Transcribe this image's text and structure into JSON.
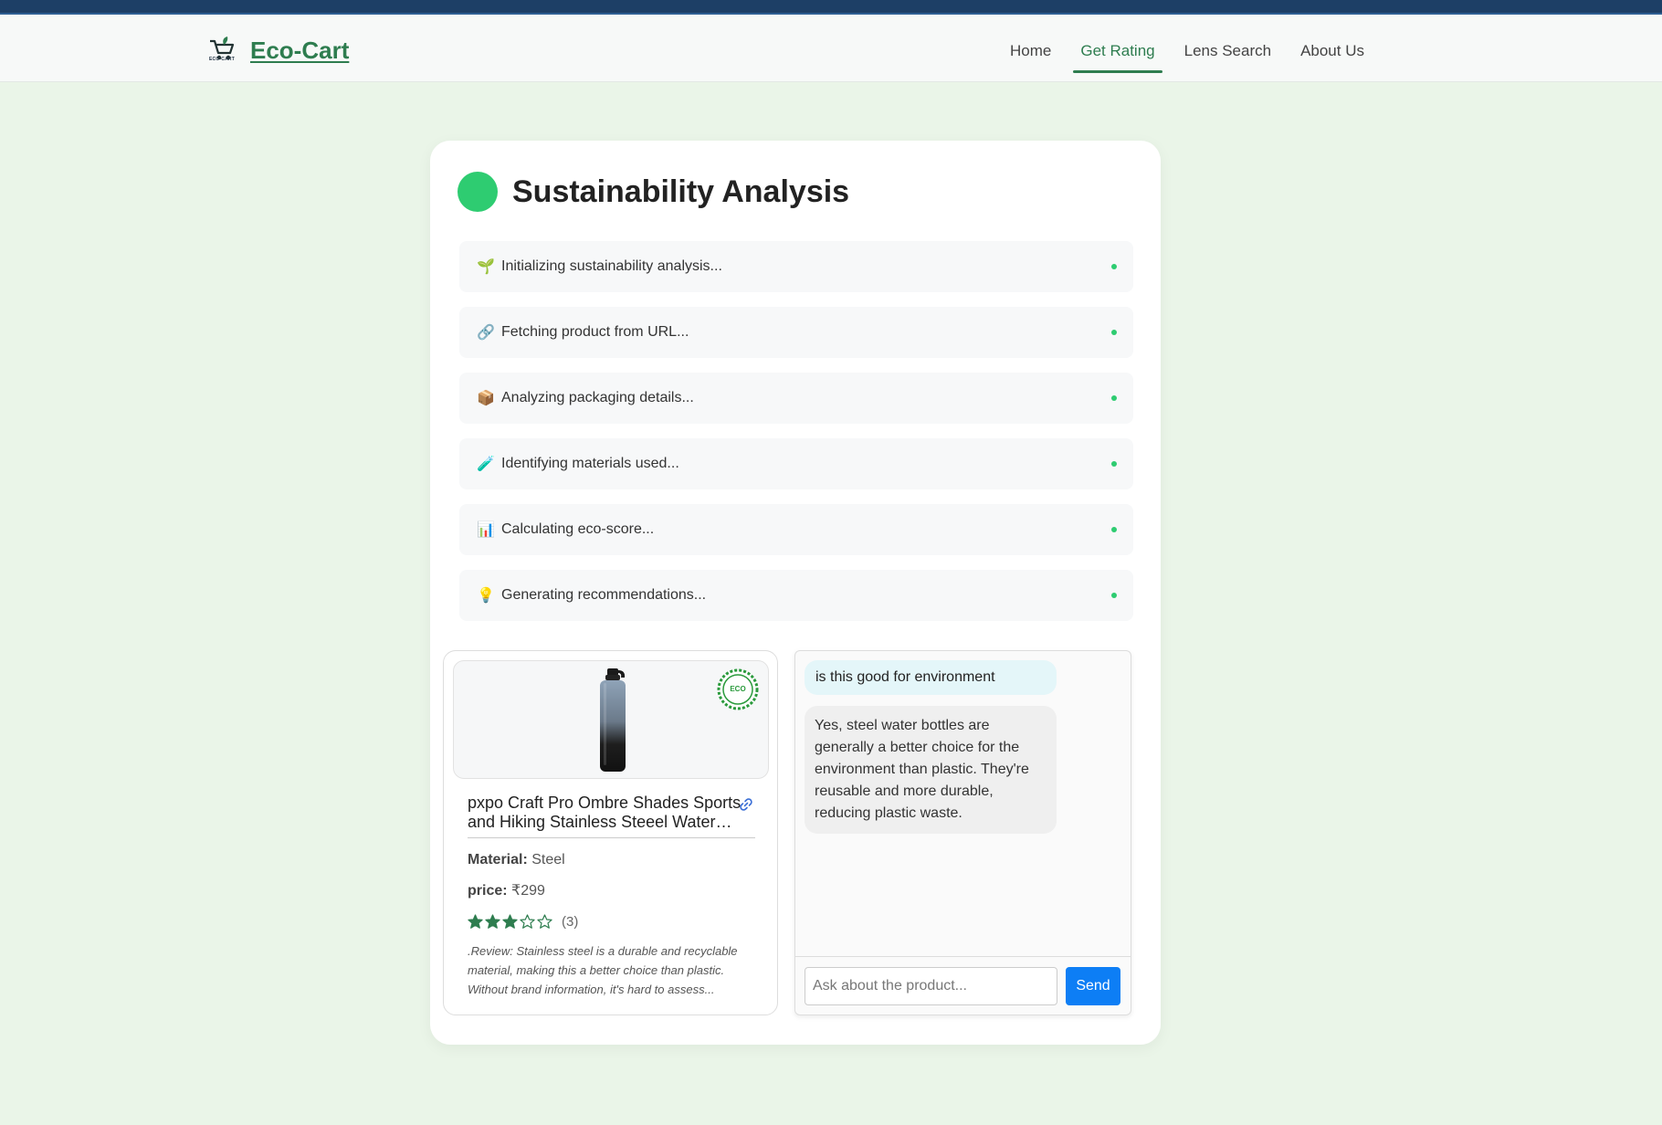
{
  "brand": {
    "name": "Eco-Cart",
    "logo_text": "ECO-CART"
  },
  "nav": {
    "items": [
      {
        "label": "Home",
        "active": false
      },
      {
        "label": "Get Rating",
        "active": true
      },
      {
        "label": "Lens Search",
        "active": false
      },
      {
        "label": "About Us",
        "active": false
      }
    ]
  },
  "analysis": {
    "title": "Sustainability Analysis",
    "steps": [
      {
        "icon": "seedling-icon",
        "glyph": "🌱",
        "label": "Initializing sustainability analysis..."
      },
      {
        "icon": "link-icon",
        "glyph": "🔗",
        "label": "Fetching product from URL..."
      },
      {
        "icon": "package-icon",
        "glyph": "📦",
        "label": "Analyzing packaging details..."
      },
      {
        "icon": "test-tube-icon",
        "glyph": "🧪",
        "label": "Identifying materials used..."
      },
      {
        "icon": "bar-chart-icon",
        "glyph": "📊",
        "label": "Calculating eco-score..."
      },
      {
        "icon": "light-bulb-icon",
        "glyph": "💡",
        "label": "Generating recommendations..."
      }
    ]
  },
  "product": {
    "title": "pxpo Craft Pro Ombre Shades Sports and Hiking Stainless Steeel Water Bottle",
    "badge_text": "ECO",
    "material_label": "Material:",
    "material_value": " Steel",
    "price_label": "price:",
    "price_value": " ₹299",
    "rating": 3,
    "rating_max": 5,
    "rating_count": "(3)",
    "review": ".Review: Stainless steel is a durable and recyclable material, making this a better choice than plastic. Without brand information, it's hard to assess..."
  },
  "chat": {
    "user_message": "is this good for environment",
    "bot_message": "Yes, steel water bottles are generally a better choice for the environment than plastic. They're reusable and more durable, reducing plastic waste.",
    "input_placeholder": "Ask about the product...",
    "send_label": "Send"
  },
  "colors": {
    "accent": "#2e7d4f",
    "status_green": "#2ecc71",
    "send_blue": "#0d7ef5",
    "page_bg": "#eaf5e8"
  }
}
